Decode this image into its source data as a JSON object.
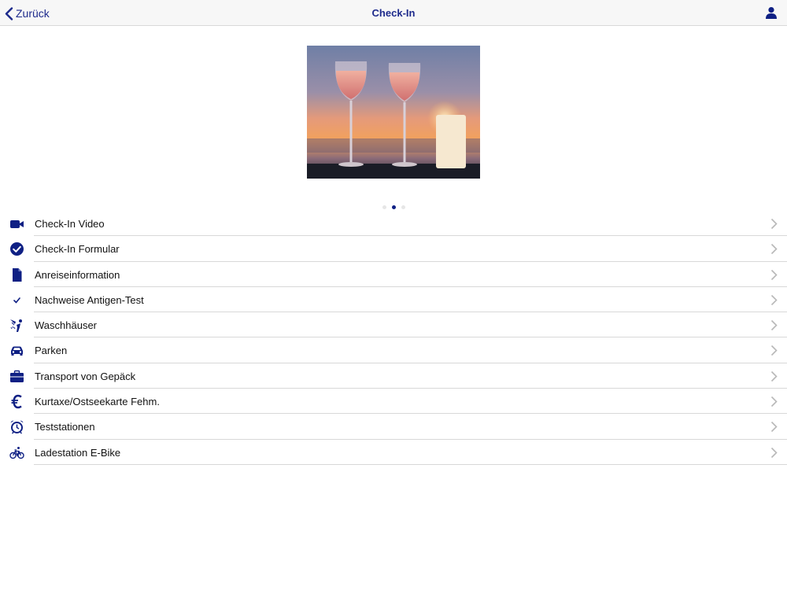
{
  "navbar": {
    "back_label": "Zurück",
    "title": "Check-In"
  },
  "pager": {
    "count": 3,
    "active_index": 1
  },
  "menu": {
    "items": [
      {
        "label": "Check-In Video",
        "icon": "video-camera-icon"
      },
      {
        "label": "Check-In Formular",
        "icon": "check-circle-icon"
      },
      {
        "label": "Anreiseinformation",
        "icon": "document-icon"
      },
      {
        "label": "Nachweise Antigen-Test",
        "icon": "checkmark-icon"
      },
      {
        "label": "Waschhäuser",
        "icon": "shower-icon"
      },
      {
        "label": "Parken",
        "icon": "car-icon"
      },
      {
        "label": "Transport von Gepäck",
        "icon": "briefcase-icon"
      },
      {
        "label": "Kurtaxe/Ostseekarte Fehm.",
        "icon": "euro-icon"
      },
      {
        "label": "Teststationen",
        "icon": "alarm-clock-icon"
      },
      {
        "label": "Ladestation E-Bike",
        "icon": "bicycle-icon"
      }
    ]
  },
  "colors": {
    "accent": "#1d2a8c",
    "icon": "#0f2084",
    "divider": "#d8d8d8",
    "chevron": "#b8b8b8"
  }
}
